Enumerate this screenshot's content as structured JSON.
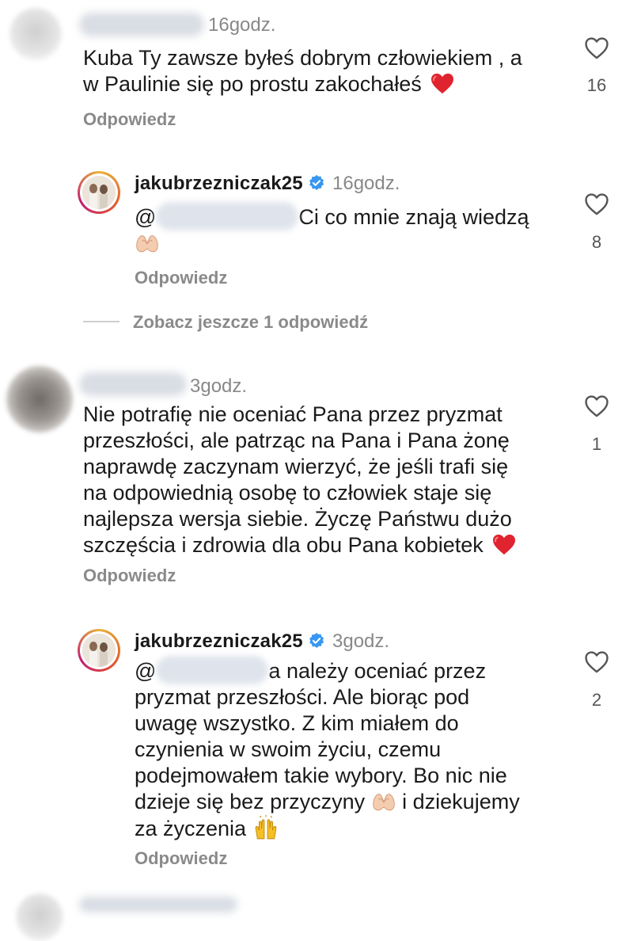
{
  "comments": [
    {
      "time": "16godz.",
      "text_line1": "Kuba Ty zawsze byłeś dobrym człowiekiem , a",
      "text_line2": "w Paulinie się po prostu zakochałeś",
      "reply": "Odpowiedz",
      "likes": "16"
    },
    {
      "username": "jakubrzezniczak25",
      "time": "16godz.",
      "mention_prefix": "@",
      "text_line1": "Ci co mnie znają wiedzą",
      "reply": "Odpowiedz",
      "likes": "8"
    },
    {
      "time": "3godz.",
      "lines": [
        "Nie potrafię nie oceniać Pana przez pryzmat",
        "przeszłości, ale patrząc na Pana i Pana żonę",
        "naprawdę zaczynam wierzyć, że jeśli trafi się",
        "na odpowiednią osobę to człowiek staje się",
        "najlepsza wersja siebie. Życzę Państwu dużo",
        "szczęścia i zdrowia dla obu Pana kobietek"
      ],
      "reply": "Odpowiedz",
      "likes": "1"
    },
    {
      "username": "jakubrzezniczak25",
      "time": "3godz.",
      "mention_prefix": "@",
      "line1_after_mention": "a należy oceniać przez",
      "lines": [
        "pryzmat przeszłości. Ale biorąc pod",
        "uwagę wszystko. Z kim miałem do",
        "czynienia w swoim życiu, czemu",
        "podejmowałem takie wybory. Bo nic nie"
      ],
      "line6_before_emoji": "dzieje się bez przyczyny",
      "line6_after_emoji": " i dziekujemy",
      "line7": "za życzenia",
      "reply": "Odpowiedz",
      "likes": "2"
    }
  ],
  "view_more": "Zobacz jeszcze 1 odpowiedź",
  "icons": {
    "like": "heart-outline-icon",
    "verified": "verified-badge-icon",
    "red_heart": "red-heart-emoji",
    "heart_hands": "heart-hands-emoji",
    "raised_hands": "raising-hands-emoji"
  },
  "colors": {
    "verified": "#3897f0",
    "red_heart": "#e0242f",
    "secondary_text": "#888888"
  }
}
